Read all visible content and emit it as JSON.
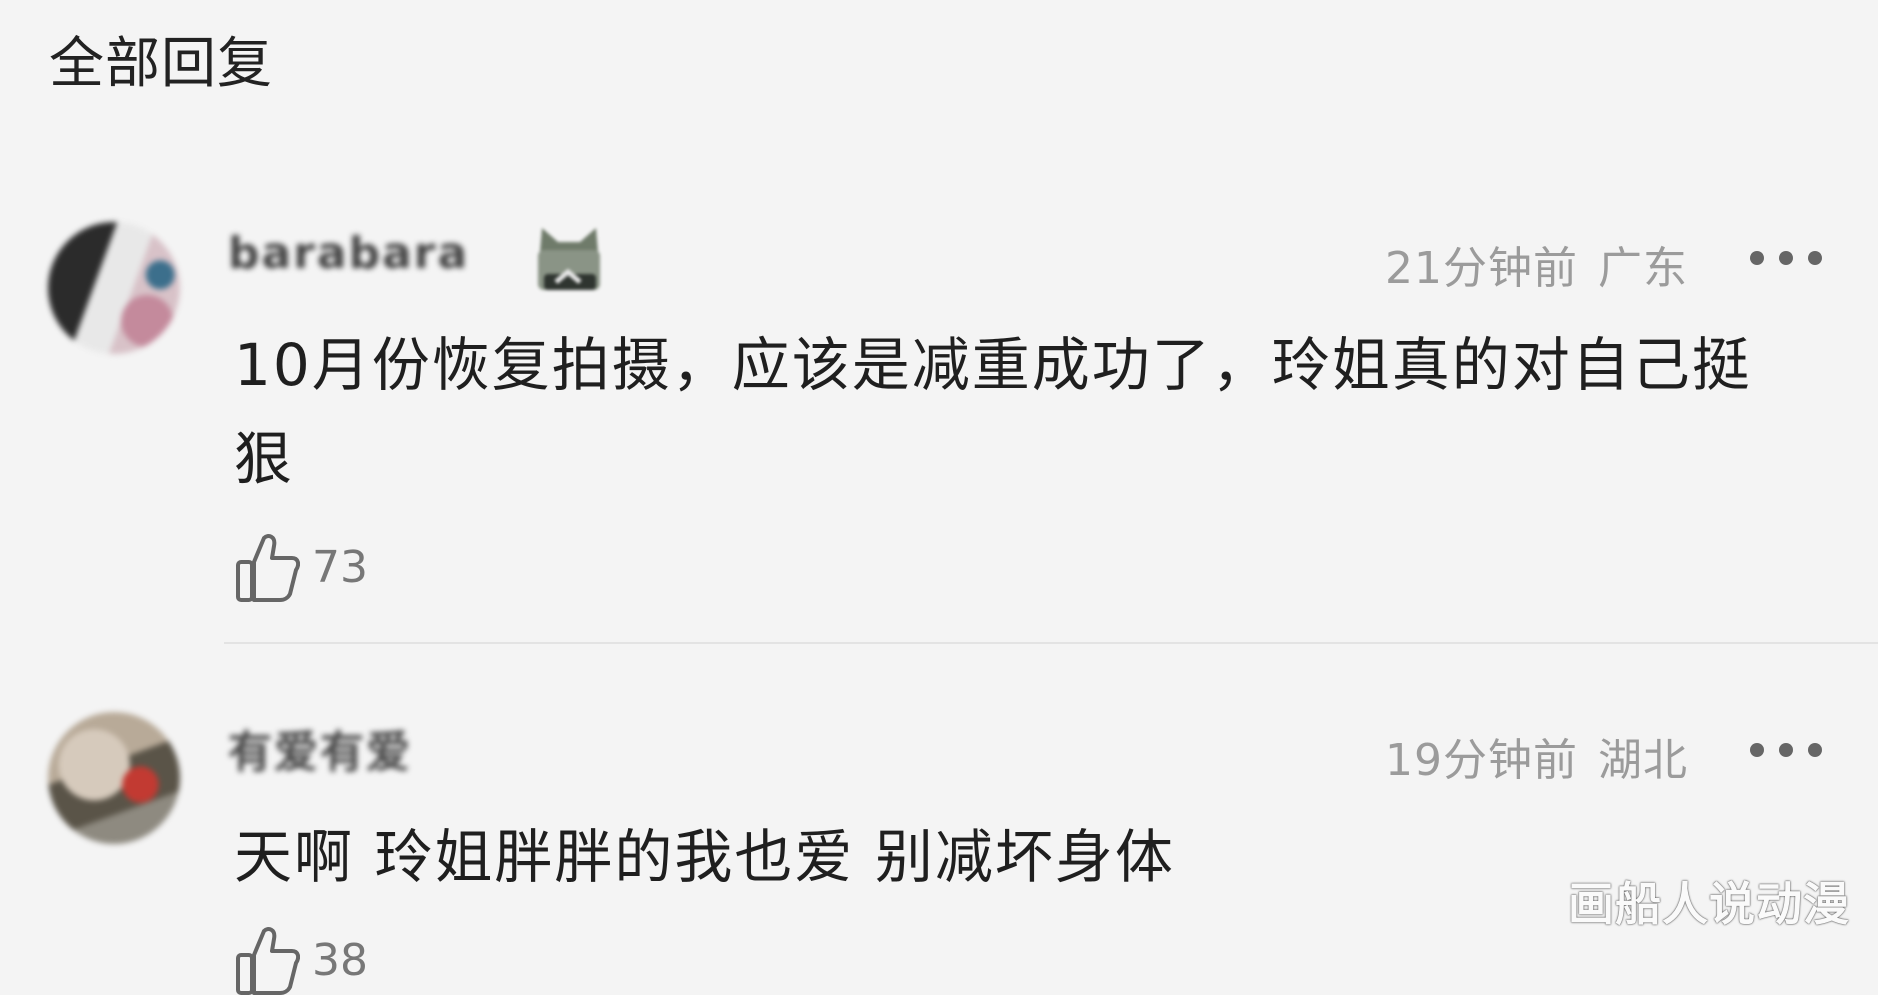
{
  "section": {
    "title": "全部回复"
  },
  "comments": [
    {
      "username": "barabara",
      "time": "21分钟前",
      "location": "广东",
      "text": "10月份恢复拍摄，应该是减重成功了，玲姐真的对自己挺狠",
      "likes": "73"
    },
    {
      "username": "有爱有爱",
      "time": "19分钟前",
      "location": "湖北",
      "text": "天啊 玲姐胖胖的我也爱 别减坏身体",
      "likes": "38"
    }
  ],
  "watermark": "画船人说动漫",
  "icons": {
    "more": "more-horizontal-icon",
    "like": "thumbs-up-icon",
    "badge": "cat-badge-icon"
  }
}
